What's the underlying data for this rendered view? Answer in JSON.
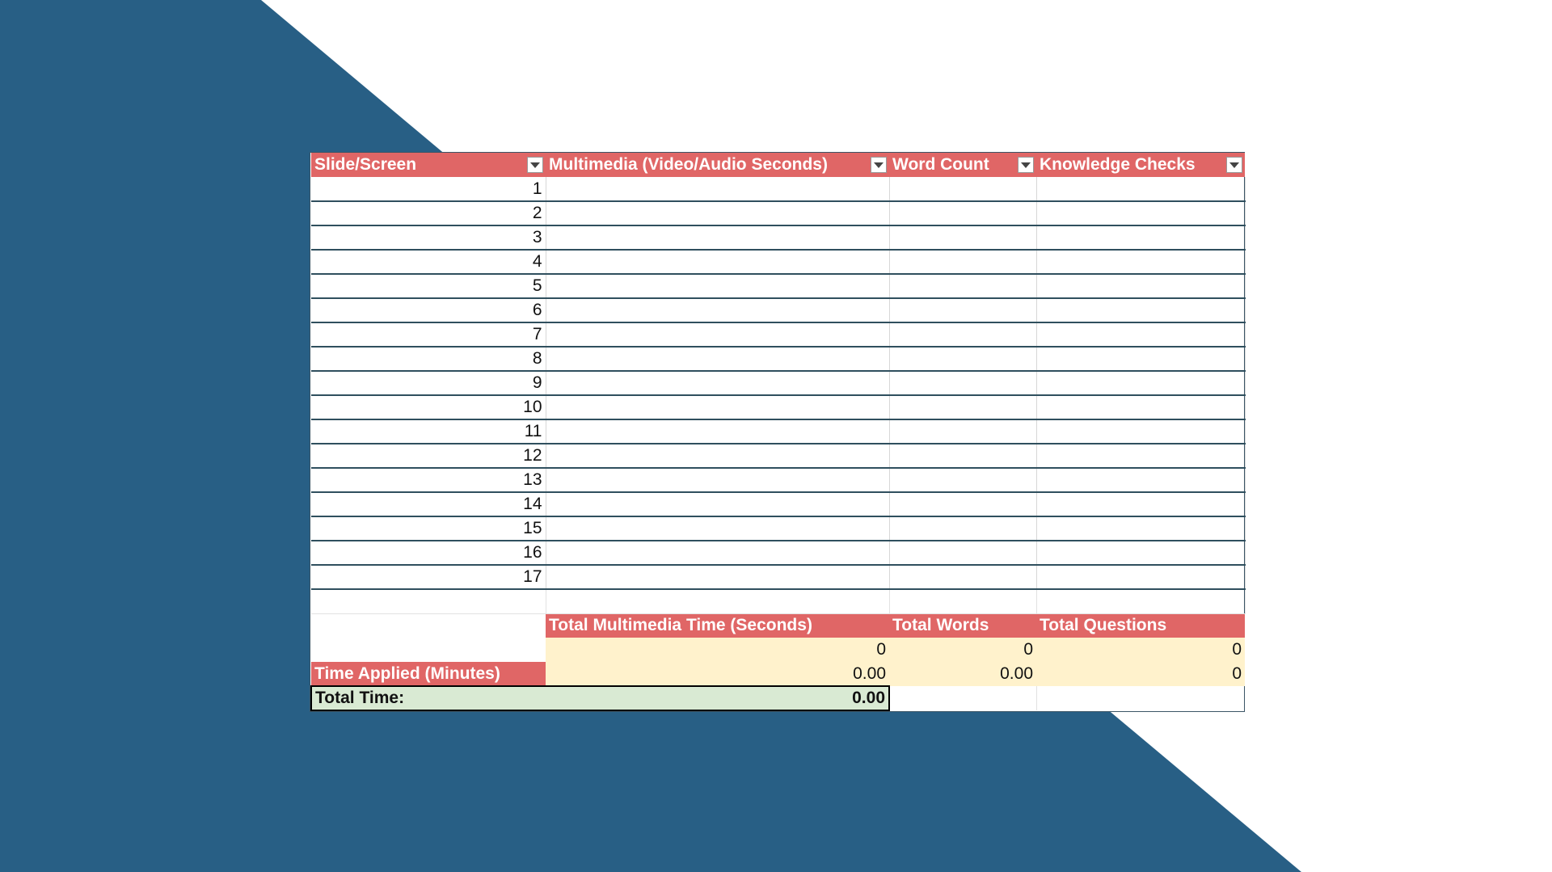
{
  "colors": {
    "background_navy": "#285f85",
    "header_red": "#e06666",
    "summary_yellow": "#fff2cc",
    "total_green": "#d9ead3"
  },
  "table": {
    "headers": [
      "Slide/Screen",
      "Multimedia (Video/Audio Seconds)",
      "Word Count",
      "Knowledge Checks"
    ],
    "filter_icon": "chevron-down-icon",
    "rows": [
      "1",
      "2",
      "3",
      "4",
      "5",
      "6",
      "7",
      "8",
      "9",
      "10",
      "11",
      "12",
      "13",
      "14",
      "15",
      "16",
      "17"
    ]
  },
  "summary": {
    "headers": {
      "multimedia": "Total Multimedia Time (Seconds)",
      "words": "Total Words",
      "questions": "Total Questions"
    },
    "totals": {
      "multimedia": "0",
      "words": "0",
      "questions": "0"
    },
    "time_applied_label": "Time Applied (Minutes)",
    "time_applied": {
      "multimedia": "0.00",
      "words": "0.00",
      "questions": "0"
    },
    "total_time_label": "Total Time:",
    "total_time_value": "0.00"
  }
}
